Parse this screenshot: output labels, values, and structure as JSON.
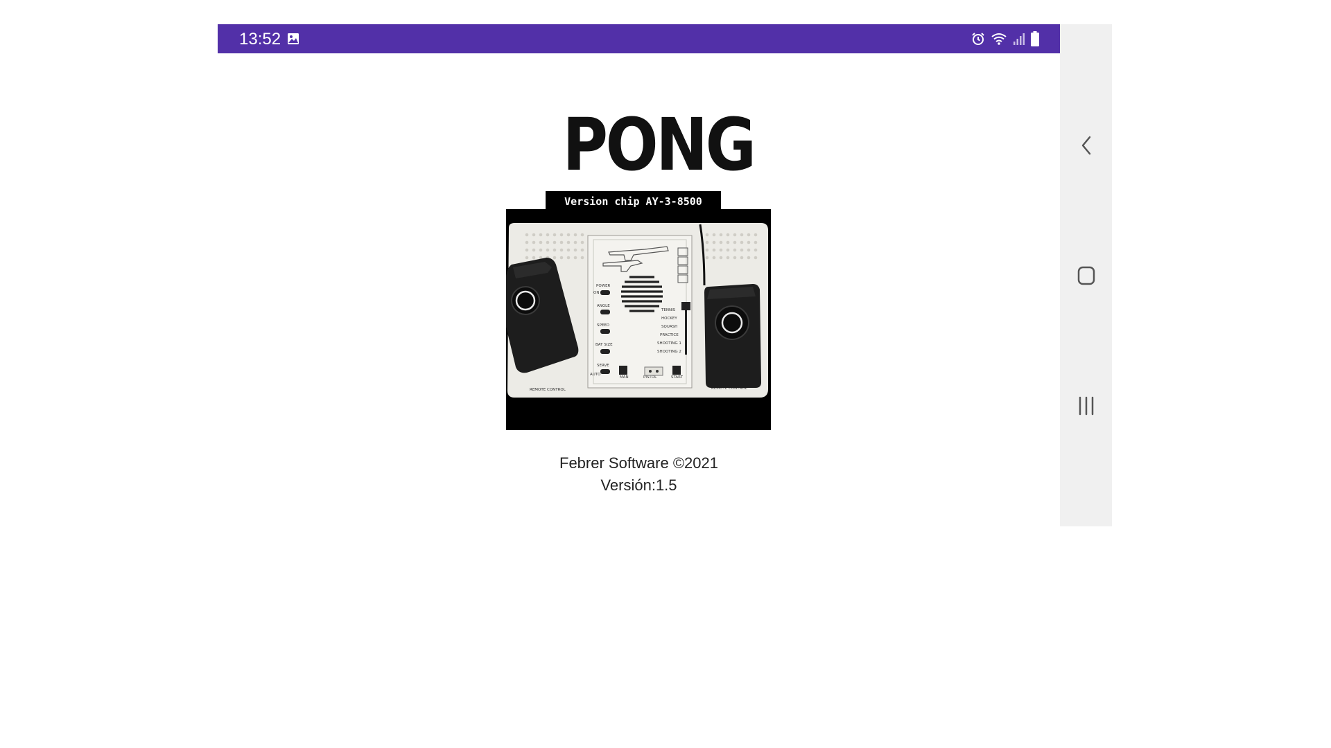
{
  "status_bar": {
    "time": "13:52",
    "background": "#5230a8",
    "icons": [
      "gallery-icon",
      "alarm-icon",
      "wifi-icon",
      "signal-icon",
      "battery-icon"
    ]
  },
  "app": {
    "title": "PONG",
    "subtitle": "Version chip AY-3-8500",
    "console_labels": {
      "power": "POWER",
      "on_off": "ON     OFF",
      "angle": "ANGLE",
      "speed": "SPEED",
      "bat_size": "BAT SIZE",
      "serve": "SERVE",
      "auto": "AUTO",
      "man": "MAN",
      "pistol": "PISTOL",
      "start": "START",
      "remote_left": "REMOTE CONTROL",
      "remote_right": "REMOTE CONTROL",
      "games": [
        "TENNIS",
        "HOCKEY",
        "SQUASH",
        "PRACTICE",
        "SHOOTING 1",
        "SHOOTING 2"
      ]
    },
    "copyright": "Febrer Software ©2021",
    "version": "Versión:1.5"
  },
  "nav_bar": {
    "buttons": [
      "back-icon",
      "home-icon",
      "recents-icon"
    ]
  }
}
